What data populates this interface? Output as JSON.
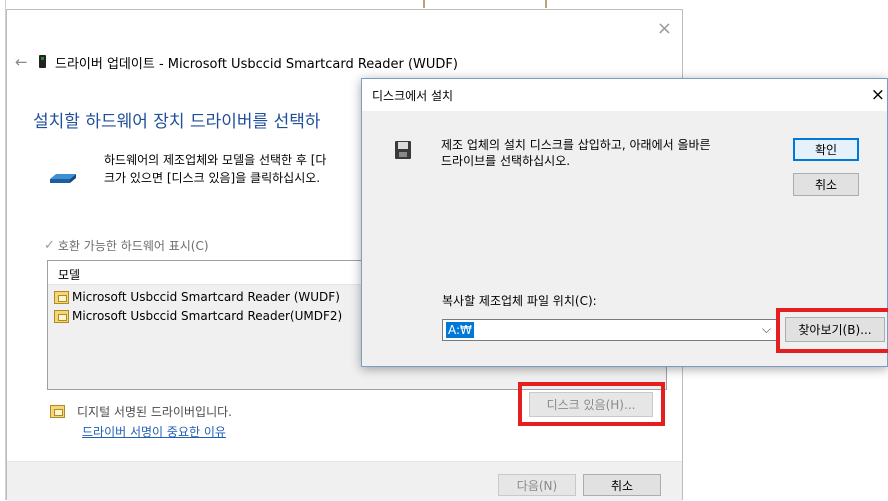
{
  "wizard": {
    "title": "드라이버 업데이트 - Microsoft Usbccid Smartcard Reader (WUDF)",
    "close_glyph": "×",
    "back_glyph": "←",
    "heading": "설치할 하드웨어 장치 드라이버를 선택하",
    "description_line1": "하드웨어의 제조업체와 모델을 선택한 후 [다",
    "description_line2": "크가 있으면 [디스크 있음]을 클릭하십시오.",
    "compat_label": "호환 가능한 하드웨어 표시(C)",
    "compat_check_glyph": "✓",
    "model_header": "모델",
    "models": [
      "Microsoft Usbccid Smartcard Reader (WUDF)",
      "Microsoft Usbccid Smartcard Reader(UMDF2)"
    ],
    "signed_text": "디지털 서명된 드라이버입니다.",
    "sig_link": "드라이버 서명이 중요한 이유",
    "have_disk_label": "디스크 있음(H)...",
    "next_label": "다음(N)",
    "cancel_label": "취소"
  },
  "disk_dialog": {
    "title": "디스크에서 설치",
    "close_glyph": "×",
    "instruction_line1": "제조 업체의 설치 디스크를 삽입하고, 아래에서 올바른",
    "instruction_line2": "드라이브를 선택하십시오.",
    "ok_label": "확인",
    "cancel_label": "취소",
    "copy_label": "복사할 제조업체 파일 위치(C):",
    "path_value": "A:₩",
    "chevron_glyph": "⌵",
    "browse_label": "찾아보기(B)..."
  },
  "colors": {
    "heading_blue": "#1f4f9a",
    "link_blue": "#1f5fb5",
    "highlight_red": "#e41f1f",
    "accent_blue": "#0078d7"
  }
}
